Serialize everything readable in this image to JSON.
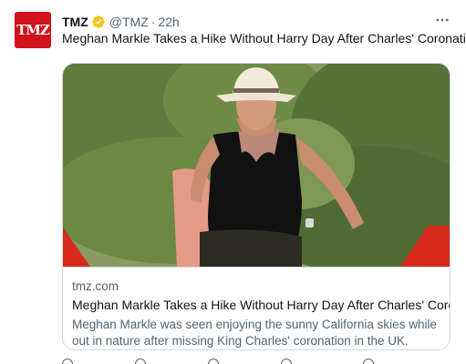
{
  "author": {
    "name": "TMZ",
    "handle": "@TMZ",
    "separator": "·",
    "time": "22h",
    "avatar_text": "TMZ",
    "verified_icon": "verified-badge-icon",
    "verified_color": "#f5c518"
  },
  "more_icon": "more-horizontal-icon",
  "tweet": {
    "text": "Meghan Markle Takes a Hike Without Harry Day After Charles' Coronation"
  },
  "card": {
    "image_description": "photo",
    "domain": "tmz.com",
    "title": "Meghan Markle Takes a Hike Without Harry Day After Charles' Coron...",
    "description": "Meghan Markle was seen enjoying the sunny California skies while out in nature after missing King Charles' coronation in the UK."
  },
  "actions": {
    "icons": [
      "reply-icon",
      "retweet-icon",
      "like-icon",
      "views-icon",
      "share-icon"
    ]
  },
  "colors": {
    "text_primary": "#0f1419",
    "text_secondary": "#536471",
    "border": "#cfd9de",
    "brand_red": "#d0121b"
  }
}
